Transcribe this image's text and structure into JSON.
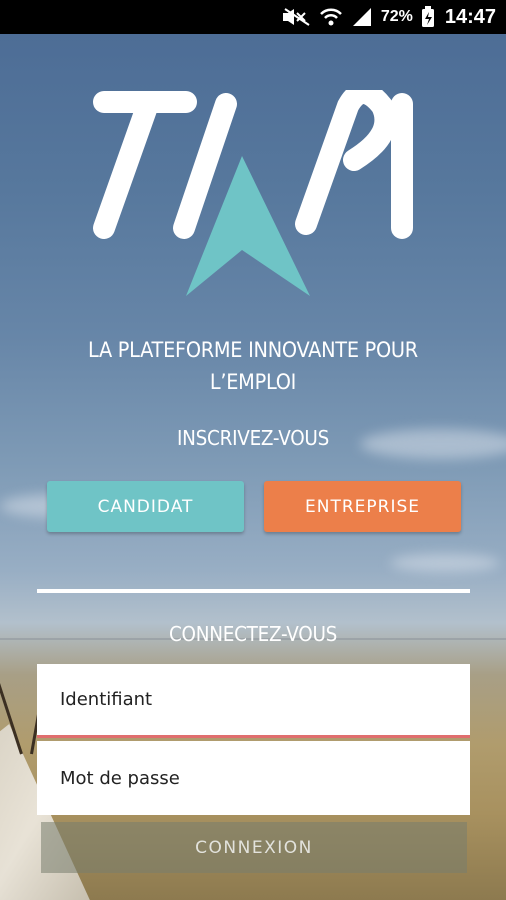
{
  "status_bar": {
    "battery_percent": "72%",
    "time": "14:47",
    "icons": [
      "silent-icon",
      "wifi-icon",
      "signal-icon",
      "battery-icon"
    ]
  },
  "brand": {
    "logo_text": "TIPI",
    "colors": {
      "teal": "#6fc4c6",
      "orange": "#ec7f4a",
      "error_underline": "#e06e6e"
    }
  },
  "tagline_line1": "LA PLATEFORME INNOVANTE POUR",
  "tagline_line2": "L’EMPLOI",
  "signup": {
    "title": "INSCRIVEZ-VOUS",
    "candidat_label": "CANDIDAT",
    "entreprise_label": "ENTREPRISE"
  },
  "login": {
    "title": "CONNECTEZ-VOUS",
    "username_placeholder": "Identifiant",
    "password_placeholder": "Mot de passe",
    "submit_label": "CONNEXION"
  }
}
